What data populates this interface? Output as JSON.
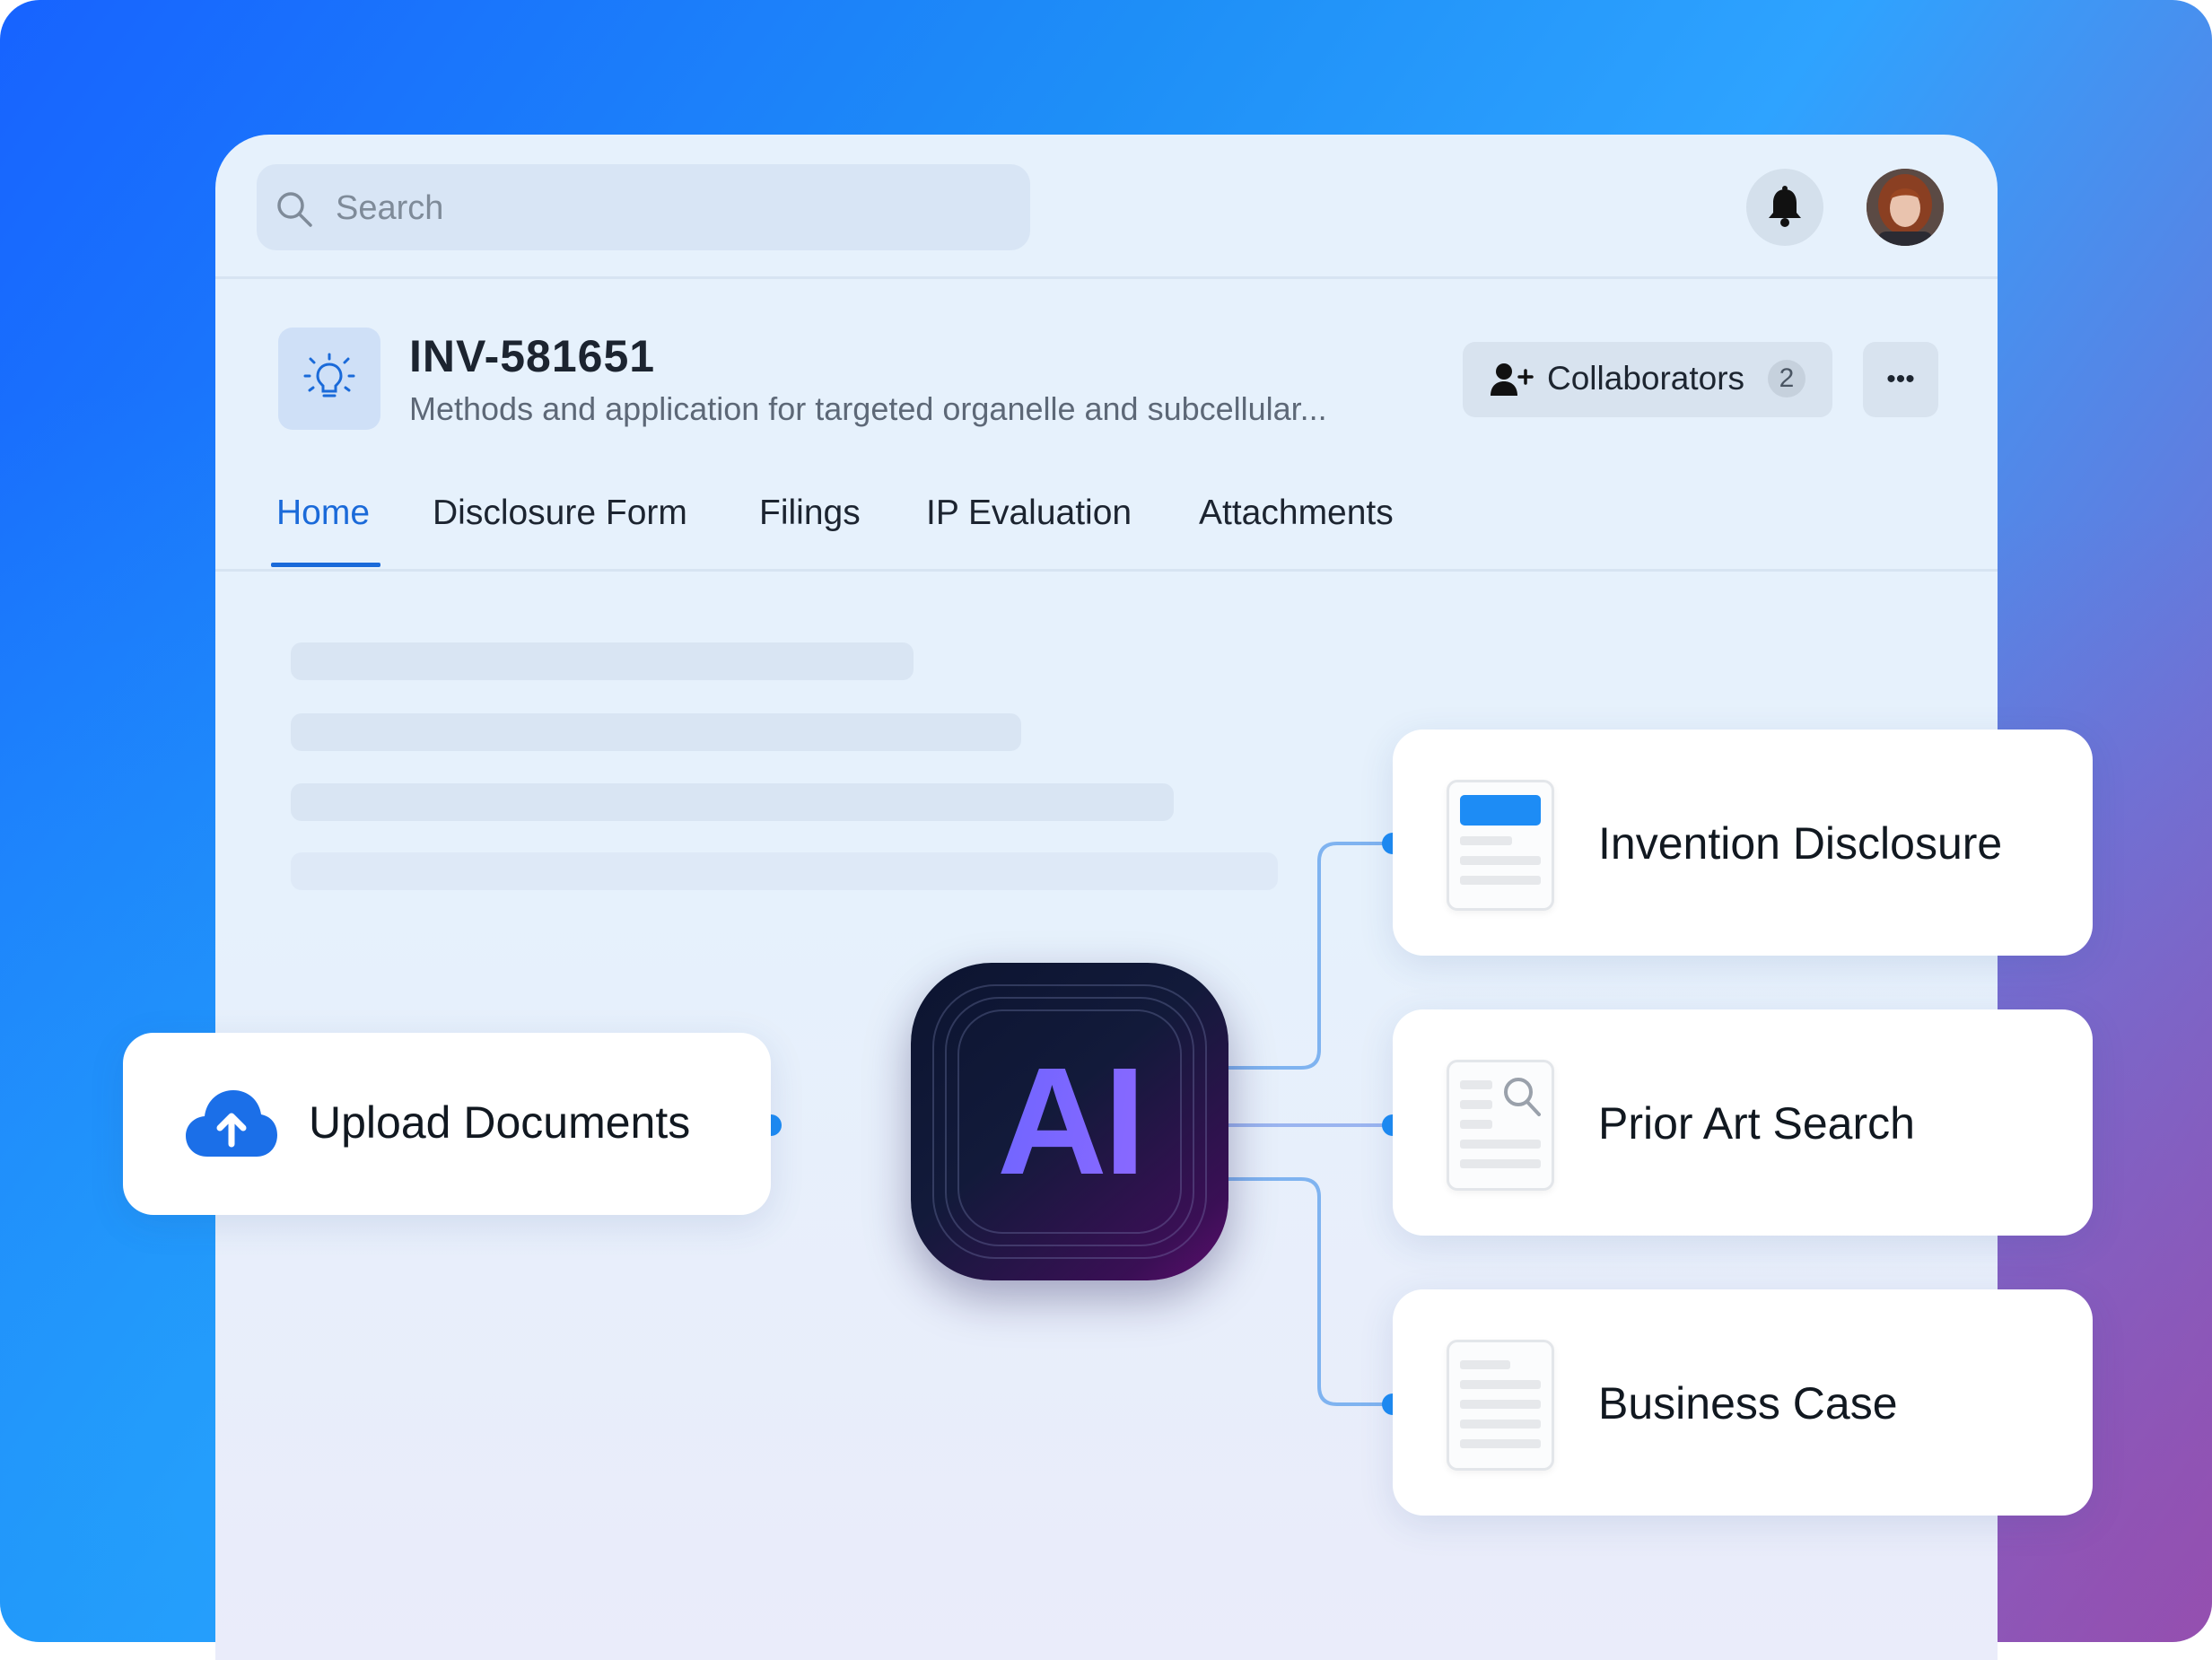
{
  "search": {
    "placeholder": "Search"
  },
  "header": {
    "id": "INV-581651",
    "description": "Methods and application for targeted organelle and subcellular...",
    "collaborators_label": "Collaborators",
    "collaborators_count": "2",
    "more_label": "•••"
  },
  "tabs": [
    {
      "label": "Home",
      "active": true
    },
    {
      "label": "Disclosure Form"
    },
    {
      "label": "Filings"
    },
    {
      "label": "IP Evaluation"
    },
    {
      "label": "Attachments"
    }
  ],
  "flow": {
    "input_label": "Upload Documents",
    "ai_label": "AI",
    "outputs": [
      {
        "label": "Invention Disclosure",
        "icon": "document-header-icon"
      },
      {
        "label": "Prior Art Search",
        "icon": "document-search-icon"
      },
      {
        "label": "Business Case",
        "icon": "document-lines-icon"
      }
    ]
  },
  "colors": {
    "accent": "#1a6ad9",
    "connector": "#1d8cf5"
  }
}
